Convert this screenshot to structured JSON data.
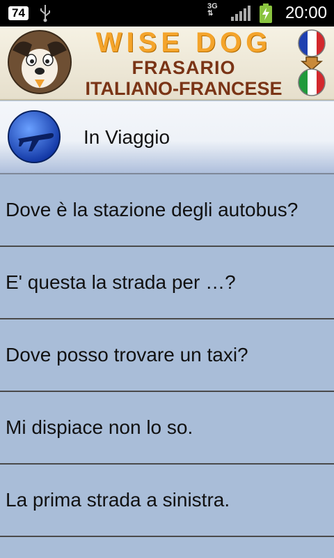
{
  "status_bar": {
    "notification_count": "74",
    "network": "3G",
    "time": "20:00"
  },
  "header": {
    "brand": "WISE DOG",
    "title": "FRASARIO",
    "subtitle": "ITALIANO-FRANCESE"
  },
  "category": {
    "label": "In Viaggio",
    "icon": "airplane-icon"
  },
  "phrases": [
    {
      "text": "Dove è la stazione degli autobus?"
    },
    {
      "text": "E' questa la strada per …?"
    },
    {
      "text": "Dove posso trovare un taxi?"
    },
    {
      "text": "Mi dispiace non lo so."
    },
    {
      "text": "La prima strada a sinistra."
    }
  ]
}
